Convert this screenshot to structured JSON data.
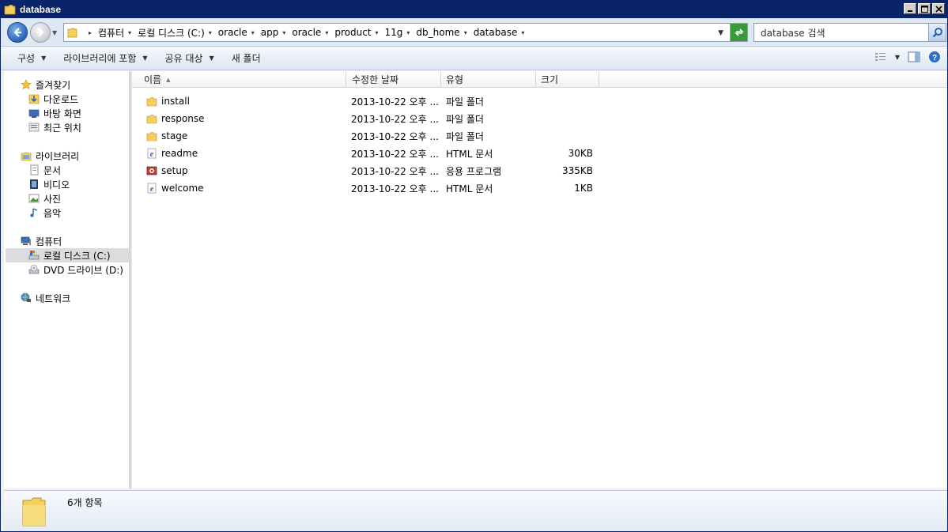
{
  "window": {
    "title": "database"
  },
  "address_bar": {
    "crumbs": [
      "컴퓨터",
      "로컬 디스크 (C:)",
      "oracle",
      "app",
      "oracle",
      "product",
      "11g",
      "db_home",
      "database"
    ]
  },
  "search": {
    "placeholder": "database 검색"
  },
  "command_bar": {
    "organize": "구성",
    "include_in_library": "라이브러리에 포함",
    "share_with": "공유 대상",
    "new_folder": "새 폴더"
  },
  "nav": {
    "favorites": {
      "label": "즐겨찾기",
      "items": [
        "다운로드",
        "바탕 화면",
        "최근 위치"
      ]
    },
    "libraries": {
      "label": "라이브러리",
      "items": [
        "문서",
        "비디오",
        "사진",
        "음악"
      ]
    },
    "computer": {
      "label": "컴퓨터",
      "items": [
        "로컬 디스크 (C:)",
        "DVD 드라이브 (D:)"
      ]
    },
    "network": {
      "label": "네트워크"
    }
  },
  "columns": {
    "name": "이름",
    "modified": "수정한 날짜",
    "type": "유형",
    "size": "크기"
  },
  "files": [
    {
      "name": "install",
      "modified": "2013-10-22 오후 ...",
      "type": "파일 폴더",
      "size": "",
      "icon": "folder-icon"
    },
    {
      "name": "response",
      "modified": "2013-10-22 오후 ...",
      "type": "파일 폴더",
      "size": "",
      "icon": "folder-icon"
    },
    {
      "name": "stage",
      "modified": "2013-10-22 오후 ...",
      "type": "파일 폴더",
      "size": "",
      "icon": "folder-icon"
    },
    {
      "name": "readme",
      "modified": "2013-10-22 오후 ...",
      "type": "HTML 문서",
      "size": "30KB",
      "icon": "html-file-icon"
    },
    {
      "name": "setup",
      "modified": "2013-10-22 오후 ...",
      "type": "응용 프로그램",
      "size": "335KB",
      "icon": "application-icon"
    },
    {
      "name": "welcome",
      "modified": "2013-10-22 오후 ...",
      "type": "HTML 문서",
      "size": "1KB",
      "icon": "html-file-icon"
    }
  ],
  "status": {
    "item_count": "6개 항목"
  },
  "colors": {
    "title_bar": "#0a246a",
    "address_bg": "#dfe8f3",
    "selected_nav": "#dcdcdc"
  }
}
